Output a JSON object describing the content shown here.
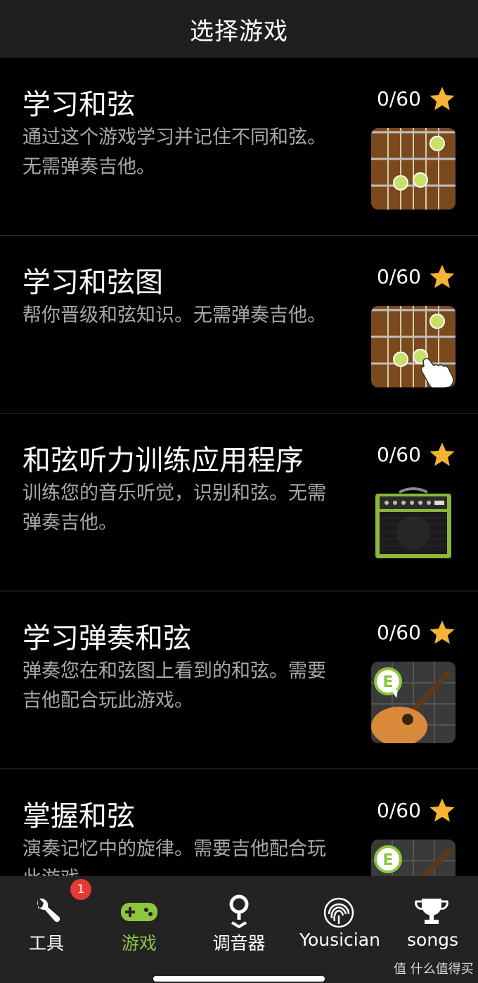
{
  "header": {
    "title": "选择游戏"
  },
  "games": [
    {
      "title": "学习和弦",
      "description": "通过这个游戏学习并记住不同和弦。无需弹奏吉他。",
      "score": "0/60",
      "thumb_icon": "fretboard-icon"
    },
    {
      "title": "学习和弦图",
      "description": "帮你晋级和弦知识。无需弹奏吉他。",
      "score": "0/60",
      "thumb_icon": "fretboard-tap-icon"
    },
    {
      "title": "和弦听力训练应用程序",
      "description": "训练您的音乐听觉，识别和弦。无需弹奏吉他。",
      "score": "0/60",
      "thumb_icon": "amplifier-icon"
    },
    {
      "title": "学习弹奏和弦",
      "description": "弹奏您在和弦图上看到的和弦。需要吉他配合玩此游戏。",
      "score": "0/60",
      "thumb_icon": "guitar-e-icon"
    },
    {
      "title": "掌握和弦",
      "description": "演奏记忆中的旋律。需要吉他配合玩此游戏。",
      "score": "0/60",
      "thumb_icon": "guitar-e-icon"
    }
  ],
  "thumb_badge_letter": "E",
  "tabs": [
    {
      "label": "工具",
      "icon": "wrench-icon",
      "active": false
    },
    {
      "label": "游戏",
      "icon": "gamepad-icon",
      "active": true
    },
    {
      "label": "调音器",
      "icon": "tuner-pin-icon",
      "active": false
    },
    {
      "label": "Yousician",
      "icon": "fingerprint-icon",
      "active": false
    },
    {
      "label": "songs",
      "icon": "trophy-icon",
      "active": false
    }
  ],
  "tools_badge": "1",
  "watermark": "值 什么值得买",
  "colors": {
    "accent": "#8cc63f",
    "star": "#f5b335",
    "badge": "#e53935",
    "header_bg": "#1f1f1f",
    "tabbar_bg": "#232323"
  }
}
